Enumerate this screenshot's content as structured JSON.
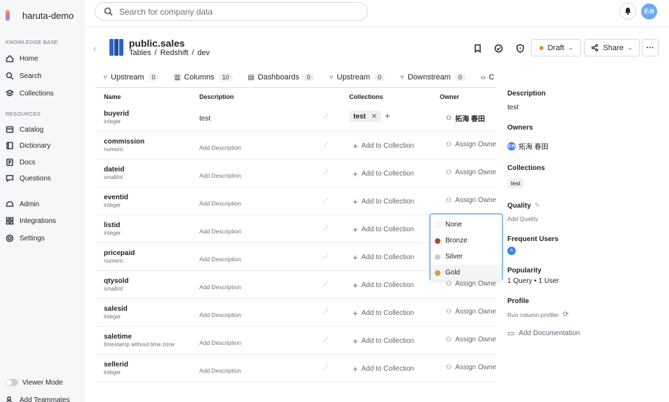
{
  "sidebar": {
    "brand": "haruta-demo",
    "knowledge_label": "KNOWLEDGE BASE",
    "knowledge_items": [
      {
        "label": "Home",
        "icon": "home-icon"
      },
      {
        "label": "Search",
        "icon": "search-icon"
      },
      {
        "label": "Collections",
        "icon": "collections-icon"
      }
    ],
    "resources_label": "RESOURCES",
    "resource_items": [
      {
        "label": "Catalog",
        "icon": "catalog-icon"
      },
      {
        "label": "Dictionary",
        "icon": "dictionary-icon"
      },
      {
        "label": "Docs",
        "icon": "docs-icon"
      },
      {
        "label": "Questions",
        "icon": "questions-icon"
      }
    ],
    "admin_items": [
      {
        "label": "Admin",
        "icon": "admin-icon"
      },
      {
        "label": "Integrations",
        "icon": "integrations-icon"
      },
      {
        "label": "Settings",
        "icon": "gear-icon"
      }
    ],
    "viewer_mode": "Viewer Mode",
    "add_teammates": "Add Teammates"
  },
  "topbar": {
    "search_placeholder": "Search for company data",
    "avatar_initials": "拓春"
  },
  "header": {
    "title": "public.sales",
    "breadcrumb": [
      "Tables",
      "/",
      "Redshift",
      "/",
      "dev"
    ],
    "draft_label": "Draft",
    "draft_color": "#e0952a",
    "share_label": "Share",
    "more_label": "···"
  },
  "tabs": [
    {
      "label": "Upstream",
      "count": "0",
      "icon": "lineage-icon"
    },
    {
      "label": "Columns",
      "count": "10",
      "icon": "columns-icon"
    },
    {
      "label": "Dashboards",
      "count": "0",
      "icon": "dashboard-icon"
    },
    {
      "label": "Upstream",
      "count": "0",
      "icon": "lineage-icon"
    },
    {
      "label": "Downstream",
      "count": "0",
      "icon": "lineage-icon"
    },
    {
      "label": "C",
      "count": "",
      "icon": "code-icon"
    }
  ],
  "table": {
    "headers": [
      "Name",
      "Description",
      "Collections",
      "Owner"
    ],
    "add_description": "Add Description",
    "add_collection": "Add to Collection",
    "assign_owner": "Assign Owner",
    "rows": [
      {
        "name": "buyerid",
        "type": "integer",
        "description": "test",
        "collection": "test",
        "owner": "拓海 春田"
      },
      {
        "name": "commission",
        "type": "numeric"
      },
      {
        "name": "dateid",
        "type": "smallint"
      },
      {
        "name": "eventid",
        "type": "integer"
      },
      {
        "name": "listid",
        "type": "integer"
      },
      {
        "name": "pricepaid",
        "type": "numeric"
      },
      {
        "name": "qtysold",
        "type": "smallint"
      },
      {
        "name": "salesid",
        "type": "integer"
      },
      {
        "name": "saletime",
        "type": "timestamp without time zone"
      },
      {
        "name": "sellerid",
        "type": "integer"
      }
    ]
  },
  "quality_dropdown": {
    "options": [
      {
        "label": "None",
        "color": "#ffffff"
      },
      {
        "label": "Bronze",
        "color": "#c0442a"
      },
      {
        "label": "Silver",
        "color": "#c8cbd0"
      },
      {
        "label": "Gold",
        "color": "#d89a2e"
      }
    ],
    "hovered": "Gold"
  },
  "right_panel": {
    "description_label": "Description",
    "description_value": "test",
    "owners_label": "Owners",
    "owner_avatar": "拓春",
    "owner_name": "拓海 春田",
    "collections_label": "Collections",
    "collection_chip": "test",
    "quality_label": "Quality",
    "add_quality": "Add Quality",
    "frequent_users_label": "Frequent Users",
    "frequent_user_initial": "A",
    "popularity_label": "Popularity",
    "popularity_value": "1 Query • 1 User",
    "profile_label": "Profile",
    "run_profiler": "Run column profiler",
    "add_documentation": "Add Documentation"
  }
}
